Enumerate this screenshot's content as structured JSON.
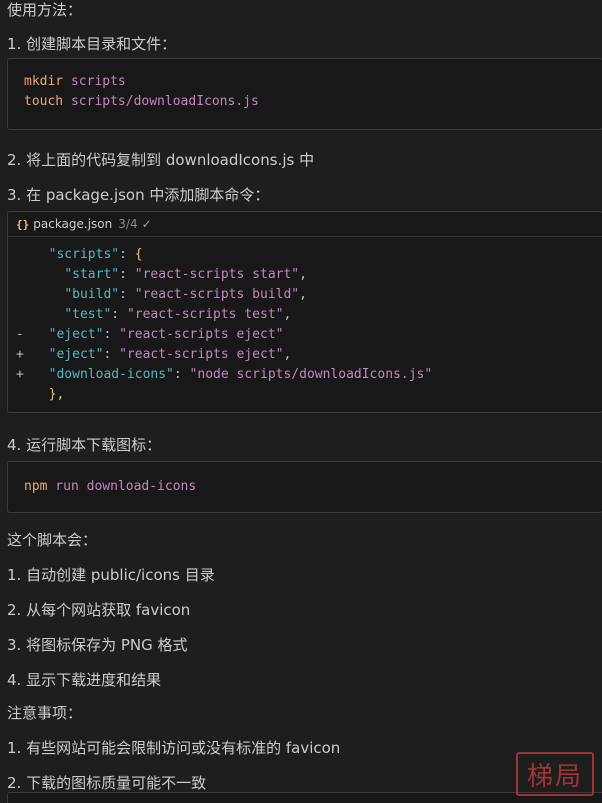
{
  "intro": "使用方法：",
  "step1": "1. 创建脚本目录和文件：",
  "code1": {
    "line1_cmd": "mkdir",
    "line1_arg": " scripts",
    "line2_cmd": "touch",
    "line2_arg": " scripts/downloadIcons.js"
  },
  "step2": "2. 将上面的代码复制到 downloadIcons.js 中",
  "step3": "3. 在 package.json 中添加脚本命令：",
  "code2": {
    "header": {
      "icon": "{}",
      "filename": "package.json",
      "count": "3/4",
      "check": "✓"
    },
    "lines": [
      {
        "prefix": "",
        "indent": "  ",
        "key": "\"scripts\"",
        "sep": ": ",
        "value": "",
        "tail": "{"
      },
      {
        "prefix": "",
        "indent": "    ",
        "key": "\"start\"",
        "sep": ": ",
        "value": "\"react-scripts start\"",
        "tail": ","
      },
      {
        "prefix": "",
        "indent": "    ",
        "key": "\"build\"",
        "sep": ": ",
        "value": "\"react-scripts build\"",
        "tail": ","
      },
      {
        "prefix": "",
        "indent": "    ",
        "key": "\"test\"",
        "sep": ": ",
        "value": "\"react-scripts test\"",
        "tail": ","
      },
      {
        "prefix": "-",
        "indent": "  ",
        "key": "\"eject\"",
        "sep": ": ",
        "value": "\"react-scripts eject\"",
        "tail": ""
      },
      {
        "prefix": "+",
        "indent": "  ",
        "key": "\"eject\"",
        "sep": ": ",
        "value": "\"react-scripts eject\"",
        "tail": ","
      },
      {
        "prefix": "+",
        "indent": "  ",
        "key": "\"download-icons\"",
        "sep": ": ",
        "value": "\"node scripts/downloadIcons.js\"",
        "tail": ""
      },
      {
        "prefix": "",
        "indent": "  ",
        "key": "",
        "sep": "",
        "value": "",
        "tail": "},"
      }
    ]
  },
  "step4": "4. 运行脚本下载图标：",
  "code3": {
    "cmd": "npm",
    "rest": " run download-icons"
  },
  "summary_title": "这个脚本会：",
  "summary": [
    "1. 自动创建 public/icons 目录",
    "2. 从每个网站获取 favicon",
    "3. 将图标保存为 PNG 格式",
    "4. 显示下载进度和结果"
  ],
  "notes_title": "注意事项：",
  "notes": [
    "1. 有些网站可能会限制访问或没有标准的 favicon",
    "2. 下载的图标质量可能不一致"
  ],
  "watermark": "梯局",
  "colors": {
    "background": "#1e1e1e",
    "code_bg": "#181818",
    "keyword": "#f0a86f",
    "string": "#c586c0",
    "key": "#56b6c2",
    "seal": "#b33a3a"
  }
}
